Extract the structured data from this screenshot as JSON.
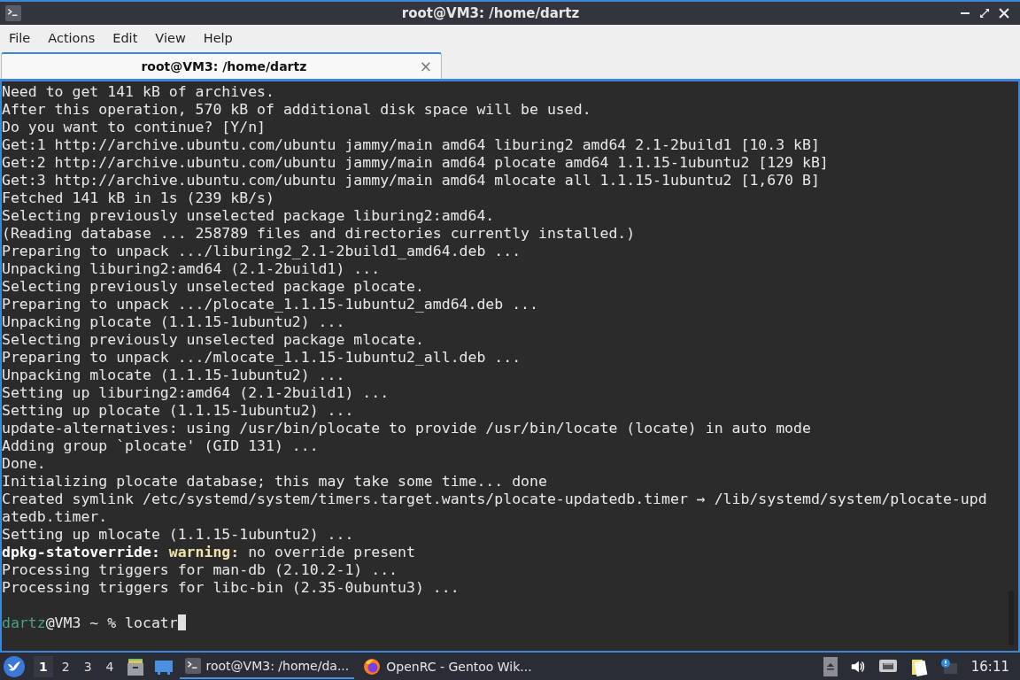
{
  "window": {
    "title": "root@VM3: /home/dartz"
  },
  "menu": [
    "File",
    "Actions",
    "Edit",
    "View",
    "Help"
  ],
  "tabs": [
    {
      "label": "root@VM3: /home/dartz",
      "selected": true,
      "close": "×"
    }
  ],
  "terminal": {
    "lines": [
      {
        "text": "Need to get 141 kB of archives."
      },
      {
        "text": "After this operation, 570 kB of additional disk space will be used."
      },
      {
        "text": "Do you want to continue? [Y/n]"
      },
      {
        "text": "Get:1 http://archive.ubuntu.com/ubuntu jammy/main amd64 liburing2 amd64 2.1-2build1 [10.3 kB]"
      },
      {
        "text": "Get:2 http://archive.ubuntu.com/ubuntu jammy/main amd64 plocate amd64 1.1.15-1ubuntu2 [129 kB]"
      },
      {
        "text": "Get:3 http://archive.ubuntu.com/ubuntu jammy/main amd64 mlocate all 1.1.15-1ubuntu2 [1,670 B]"
      },
      {
        "text": "Fetched 141 kB in 1s (239 kB/s)"
      },
      {
        "text": "Selecting previously unselected package liburing2:amd64."
      },
      {
        "text": "(Reading database ... 258789 files and directories currently installed.)"
      },
      {
        "text": "Preparing to unpack .../liburing2_2.1-2build1_amd64.deb ..."
      },
      {
        "text": "Unpacking liburing2:amd64 (2.1-2build1) ..."
      },
      {
        "text": "Selecting previously unselected package plocate."
      },
      {
        "text": "Preparing to unpack .../plocate_1.1.15-1ubuntu2_amd64.deb ..."
      },
      {
        "text": "Unpacking plocate (1.1.15-1ubuntu2) ..."
      },
      {
        "text": "Selecting previously unselected package mlocate."
      },
      {
        "text": "Preparing to unpack .../mlocate_1.1.15-1ubuntu2_all.deb ..."
      },
      {
        "text": "Unpacking mlocate (1.1.15-1ubuntu2) ..."
      },
      {
        "text": "Setting up liburing2:amd64 (2.1-2build1) ..."
      },
      {
        "text": "Setting up plocate (1.1.15-1ubuntu2) ..."
      },
      {
        "text": "update-alternatives: using /usr/bin/plocate to provide /usr/bin/locate (locate) in auto mode"
      },
      {
        "text": "Adding group `plocate' (GID 131) ..."
      },
      {
        "text": "Done."
      },
      {
        "text": "Initializing plocate database; this may take some time... done"
      },
      {
        "text": "Created symlink /etc/systemd/system/timers.target.wants/plocate-updatedb.timer → /lib/systemd/system/plocate-upd"
      },
      {
        "text": "atedb.timer."
      },
      {
        "text": "Setting up mlocate (1.1.15-1ubuntu2) ..."
      },
      {
        "segments": [
          {
            "text": "dpkg-statoverride: ",
            "kind": "bold"
          },
          {
            "text": "warning:",
            "kind": "warning"
          },
          {
            "text": " no override present",
            "kind": "plain"
          }
        ]
      },
      {
        "text": "Processing triggers for man-db (2.10.2-1) ..."
      },
      {
        "text": "Processing triggers for libc-bin (2.35-0ubuntu3) ..."
      }
    ],
    "prompt": {
      "user": "dartz",
      "rest": "@VM3 ~ % locatr",
      "cursor": true
    }
  },
  "taskbar": {
    "workspaces": [
      {
        "label": "1",
        "selected": true
      },
      {
        "label": "2",
        "selected": false
      },
      {
        "label": "3",
        "selected": false
      },
      {
        "label": "4",
        "selected": false
      }
    ],
    "tasks": [
      {
        "label": "root@VM3: /home/da...",
        "kind": "terminal",
        "selected": true
      },
      {
        "label": "OpenRC - Gentoo Wik...",
        "kind": "browser",
        "selected": false
      }
    ],
    "clock": "16:11"
  }
}
